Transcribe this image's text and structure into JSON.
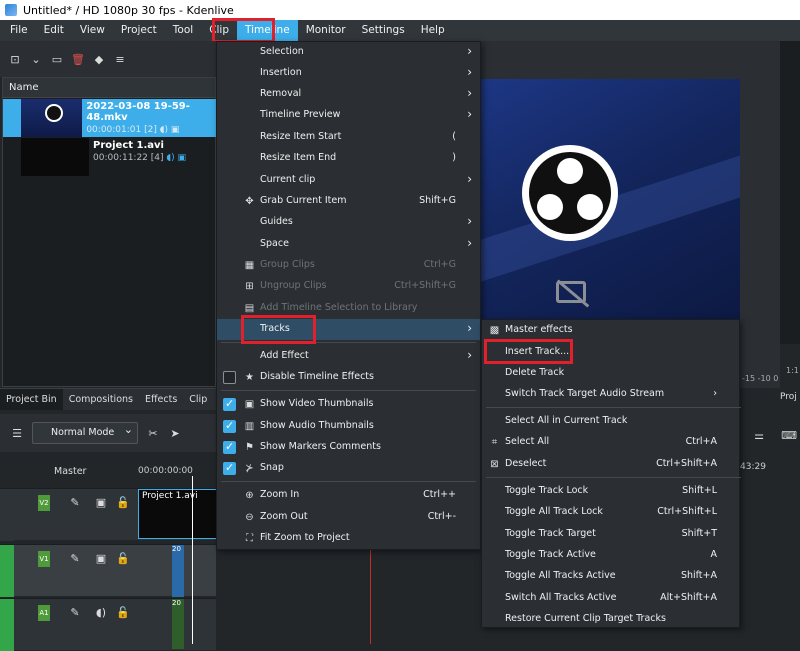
{
  "window": {
    "title": "Untitled* / HD 1080p 30 fps - Kdenlive"
  },
  "menubar": [
    "File",
    "Edit",
    "View",
    "Project",
    "Tool",
    "Clip",
    "Timeline",
    "Monitor",
    "Settings",
    "Help"
  ],
  "bin": {
    "header": "Name",
    "clips": [
      {
        "name": "2022-03-08 19-59-48.mkv",
        "meta": "00:00:01:01 [2]"
      },
      {
        "name": "Project 1.avi",
        "meta": "00:00:11:22 [4]"
      }
    ]
  },
  "tabs": [
    "Project Bin",
    "Compositions",
    "Effects",
    "Clip"
  ],
  "timeline_toolbar": {
    "mode": "Normal Mode"
  },
  "ruler": {
    "master": "Master",
    "timecode": "00:00:00:00",
    "right_tc": "43:29"
  },
  "tracks": [
    {
      "label": "V2",
      "clip": "Project 1.avi"
    },
    {
      "label": "V1",
      "clip": "20"
    },
    {
      "label": "A1",
      "clip": "20"
    }
  ],
  "monitor_side": {
    "t1": "-15 -10 0",
    "t2": "1:1",
    "tab": "Proj"
  },
  "timeline_menu": {
    "items": [
      {
        "label": "Selection",
        "submenu": true
      },
      {
        "label": "Insertion",
        "submenu": true
      },
      {
        "label": "Removal",
        "submenu": true
      },
      {
        "label": "Timeline Preview",
        "submenu": true
      },
      {
        "label": "Resize Item Start",
        "shortcut": "("
      },
      {
        "label": "Resize Item End",
        "shortcut": ")"
      },
      {
        "label": "Current clip",
        "submenu": true
      },
      {
        "label": "Grab Current Item",
        "shortcut": "Shift+G",
        "icon": "move-icon"
      },
      {
        "label": "Guides",
        "submenu": true
      },
      {
        "label": "Space",
        "submenu": true
      },
      {
        "label": "Group Clips",
        "shortcut": "Ctrl+G",
        "disabled": true
      },
      {
        "label": "Ungroup Clips",
        "shortcut": "Ctrl+Shift+G",
        "disabled": true
      },
      {
        "label": "Add Timeline Selection to Library",
        "disabled": true
      },
      {
        "label": "Tracks",
        "submenu": true,
        "highlighted": true
      },
      {
        "label": "Add Effect",
        "submenu": true
      },
      {
        "label": "Disable Timeline Effects",
        "check": false
      },
      {
        "label": "Show Video Thumbnails",
        "check": true
      },
      {
        "label": "Show Audio Thumbnails",
        "check": true
      },
      {
        "label": "Show Markers Comments",
        "check": true
      },
      {
        "label": "Snap",
        "check": true
      },
      {
        "label": "Zoom In",
        "shortcut": "Ctrl++"
      },
      {
        "label": "Zoom Out",
        "shortcut": "Ctrl+-"
      },
      {
        "label": "Fit Zoom to Project"
      }
    ]
  },
  "tracks_submenu": {
    "items": [
      {
        "label": "Master effects"
      },
      {
        "label": "Insert Track...",
        "highlighted": true
      },
      {
        "label": "Delete Track"
      },
      {
        "label": "Switch Track Target Audio Stream",
        "submenu": true
      },
      {
        "label": "Select All in Current Track"
      },
      {
        "label": "Select All",
        "shortcut": "Ctrl+A"
      },
      {
        "label": "Deselect",
        "shortcut": "Ctrl+Shift+A"
      },
      {
        "label": "Toggle Track Lock",
        "shortcut": "Shift+L"
      },
      {
        "label": "Toggle All Track Lock",
        "shortcut": "Ctrl+Shift+L"
      },
      {
        "label": "Toggle Track Target",
        "shortcut": "Shift+T"
      },
      {
        "label": "Toggle Track Active",
        "shortcut": "A"
      },
      {
        "label": "Toggle All Tracks Active",
        "shortcut": "Shift+A"
      },
      {
        "label": "Switch All Tracks Active",
        "shortcut": "Alt+Shift+A"
      },
      {
        "label": "Restore Current Clip Target Tracks"
      }
    ]
  },
  "colors": {
    "accent": "#3daee9",
    "highlight_box": "#e0202a",
    "menu_bg": "#2b2f33"
  }
}
